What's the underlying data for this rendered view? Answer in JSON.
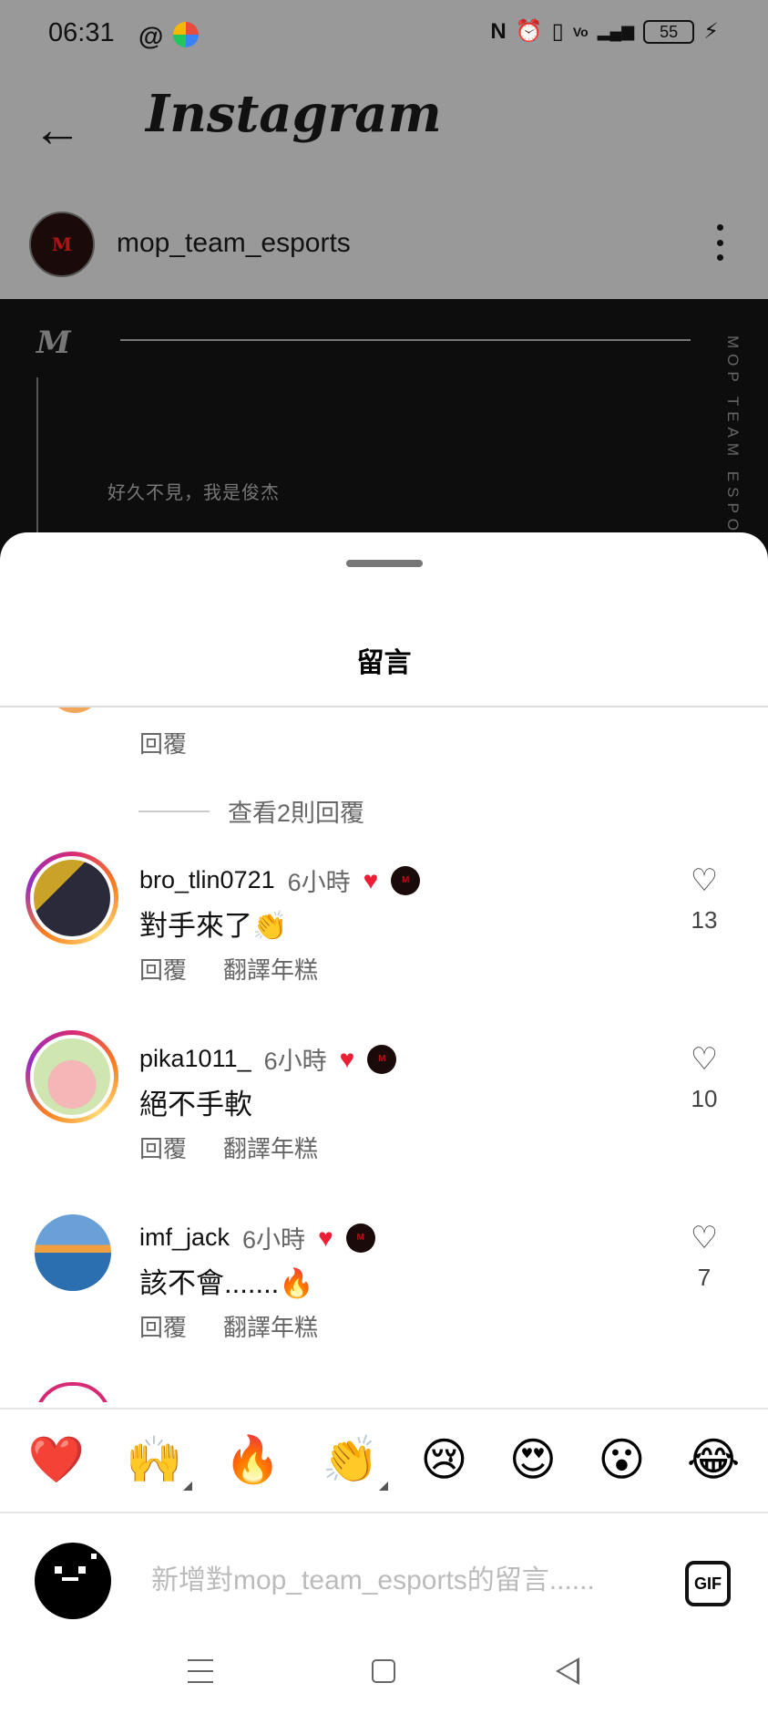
{
  "status_bar": {
    "time": "06:31",
    "battery": "55"
  },
  "header": {
    "back_icon": "back-arrow-icon",
    "app_title": "Instagram"
  },
  "post": {
    "username": "mop_team_esports",
    "image_caption": "好久不見，我是俊杰",
    "image_side_text": "MOP TEAM ESPOR"
  },
  "sheet": {
    "title": "留言",
    "reply_label_top": "回覆",
    "view_replies": "查看2則回覆",
    "comments": [
      {
        "username": "bro_tlin0721",
        "time": "6小時",
        "text": "對手來了👏",
        "reply": "回覆",
        "translate": "翻譯年糕",
        "likes": "13"
      },
      {
        "username": "pika1011_",
        "time": "6小時",
        "text": "絕不手軟",
        "reply": "回覆",
        "translate": "翻譯年糕",
        "likes": "10"
      },
      {
        "username": "imf_jack",
        "time": "6小時",
        "text": "該不會.......🔥",
        "reply": "回覆",
        "translate": "翻譯年糕",
        "likes": "7"
      }
    ]
  },
  "emoji_bar": [
    "❤️",
    "🙌",
    "🔥",
    "👏",
    "😢",
    "😍",
    "😮",
    "😂"
  ],
  "comment_input": {
    "placeholder": "新增對mop_team_esports的留言......",
    "gif_label": "GIF"
  }
}
